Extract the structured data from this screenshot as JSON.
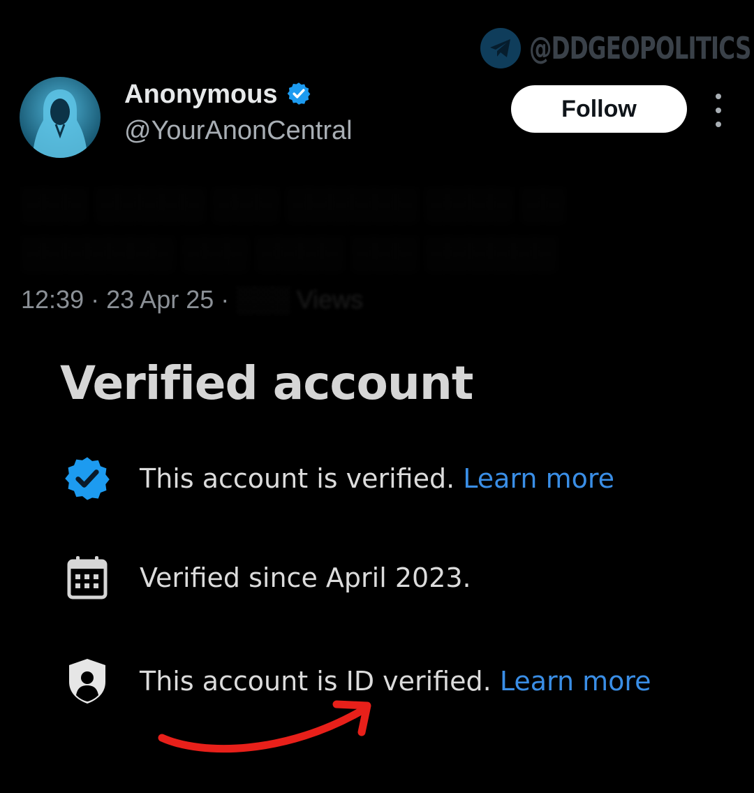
{
  "watermark": {
    "text": "@DDGEOPOLITICS",
    "icon": "telegram-icon"
  },
  "tweet": {
    "author_name": "Anonymous",
    "author_handle": "@YourAnonCentral",
    "follow_label": "Follow",
    "more_icon": "more-vertical-icon",
    "body_obscured": "░░░ ░░░░░ ░░░ ░░░░░░ ░░░░ ░░ ░░░░░░░ ░░░ ░░░░ ░░░ ░░░░░░",
    "time": "12:39",
    "date": "23 Apr 25",
    "separator": "·",
    "views_obscured": "░░░ Views"
  },
  "verified_panel": {
    "title": "Verified account",
    "rows": [
      {
        "icon": "verified-badge-icon",
        "text": "This account is verified.",
        "link": "Learn more"
      },
      {
        "icon": "calendar-icon",
        "text": "Verified since April 2023."
      },
      {
        "icon": "id-shield-icon",
        "text": "This account is ID verified.",
        "link": "Learn more"
      }
    ]
  },
  "colors": {
    "background": "#000000",
    "verified_blue": "#1d9bf0",
    "link_blue": "#3a8ee6",
    "annotation_red": "#e8201a"
  }
}
